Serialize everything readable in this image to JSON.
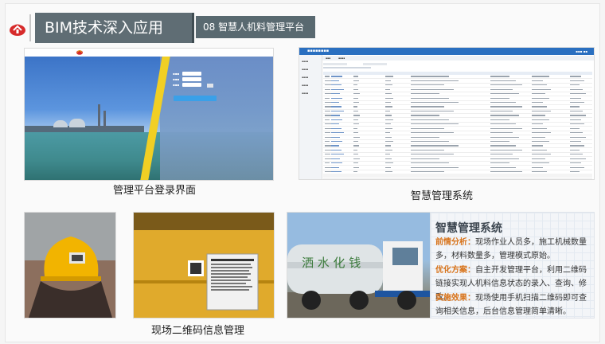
{
  "header": {
    "title": "BIM技术深入应用",
    "subtitle": "08 智慧人机料管理平台"
  },
  "captions": {
    "login": "管理平台登录界面",
    "system": "智慧管理系统",
    "qr": "现场二维码信息管理"
  },
  "info_panel": {
    "title": "智慧管理系统",
    "items": [
      {
        "label": "前情分析：",
        "text": "现场作业人员多，施工机械数量多，材料数量多，管理模式原始。"
      },
      {
        "label": "优化方案：",
        "text": "自主开发管理平台，利用二维码链接实现人机料信息状态的录入、查询、修改。"
      },
      {
        "label": "实施效果：",
        "text": "现场使用手机扫描二维码即可查询相关信息，后台信息管理简单清晰。"
      }
    ]
  },
  "colors": {
    "header_bg": "#5f6d74",
    "sub_bg": "#596970",
    "accent_orange": "#d8731a",
    "system_blue": "#2a6fc0"
  },
  "icons": {
    "logo": "company-logo-icon"
  }
}
